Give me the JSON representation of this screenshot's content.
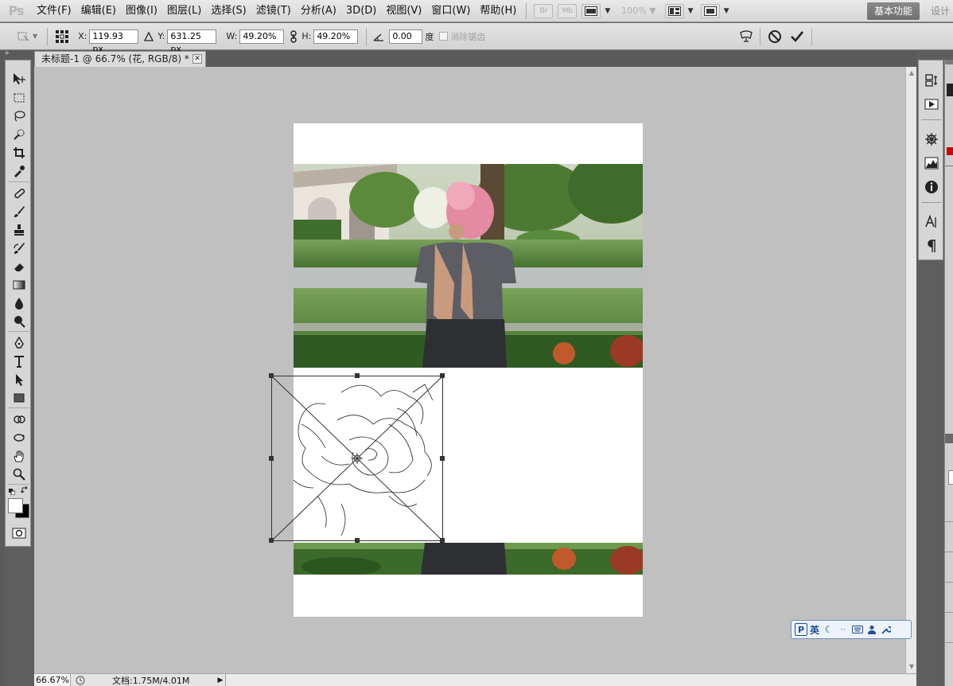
{
  "app": {
    "logo": "Ps"
  },
  "menu": [
    "文件(F)",
    "编辑(E)",
    "图像(I)",
    "图层(L)",
    "选择(S)",
    "滤镜(T)",
    "分析(A)",
    "3D(D)",
    "视图(V)",
    "窗口(W)",
    "帮助(H)"
  ],
  "menubar_right": {
    "br_label": "Br",
    "mb_label": "Mb",
    "zoom_value": "100%",
    "workspace_active": "基本功能",
    "workspace_next": "设计"
  },
  "options": {
    "x_label": "X:",
    "x_value": "119.93 px",
    "y_label": "Y:",
    "y_value": "631.25 px",
    "w_label": "W:",
    "w_value": "49.20%",
    "h_label": "H:",
    "h_value": "49.20%",
    "angle_value": "0.00",
    "angle_unit": "度",
    "antialias_label": "消除锯齿"
  },
  "document": {
    "tab_title": "未标题-1 @ 66.7% (花, RGB/8) *",
    "status_zoom": "66.67%",
    "status_doc": "文档:1.75M/4.01M"
  },
  "ime": {
    "lang": "英"
  },
  "colors": {
    "canvas_bg": "#c0c0c0",
    "panel_bg": "#d6d6d6",
    "accent_dark": "#5a5a5a"
  }
}
